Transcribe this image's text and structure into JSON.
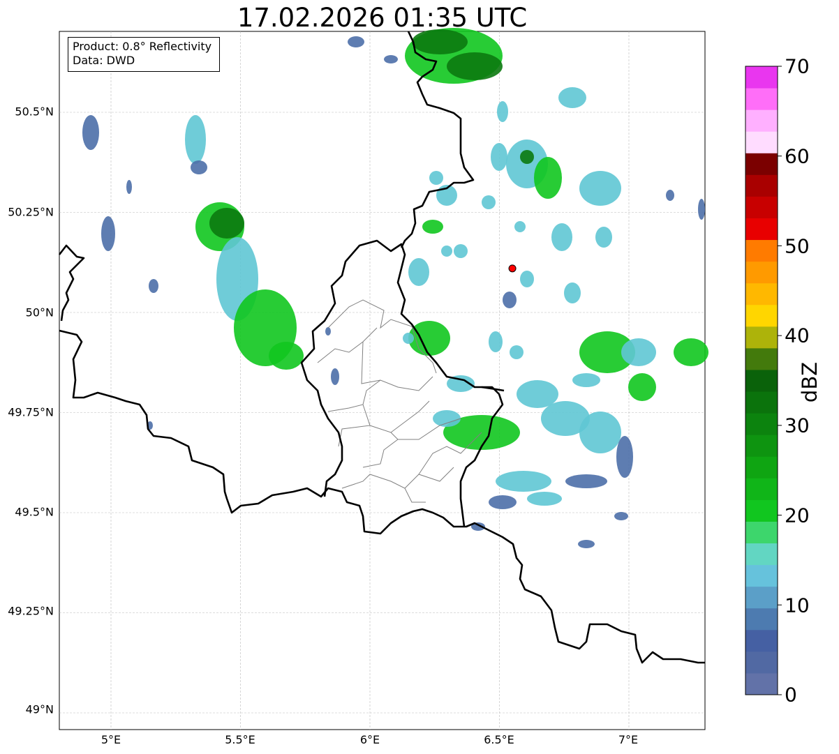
{
  "title": "17.02.2026 01:35 UTC",
  "info": {
    "product": "Product: 0.8° Reflectivity",
    "data": "Data: DWD"
  },
  "latitude_labels": [
    "50.5°N",
    "50.25°N",
    "50°N",
    "49.75°N",
    "49.5°N",
    "49.25°N",
    "49°N"
  ],
  "longitude_labels": [
    "5°E",
    "5.5°E",
    "6°E",
    "6.5°E",
    "7°E"
  ],
  "colorbar": {
    "label": "dBZ",
    "ticks": [
      "0",
      "10",
      "20",
      "30",
      "40",
      "50",
      "60",
      "70"
    ],
    "colors": [
      "#6272a8",
      "#5169a3",
      "#4560a3",
      "#4d7bb0",
      "#5b9fc8",
      "#66c2dc",
      "#62d6c2",
      "#3dd66c",
      "#11c61f",
      "#10b518",
      "#0fa512",
      "#0e9410",
      "#0c830e",
      "#0b730c",
      "#0a620a",
      "#437a0c",
      "#adb30a",
      "#ffd600",
      "#ffb800",
      "#ff9a00",
      "#ff7b00",
      "#e80000",
      "#c80000",
      "#a90000",
      "#7b0000",
      "#ffdcff",
      "#ffb0ff",
      "#ff6ef8",
      "#e936ef"
    ]
  },
  "radar_site": {
    "lon": 6.55,
    "lat": 50.11,
    "color": "#ff0000"
  },
  "colors": {
    "weak": "#4d6fa8",
    "light": "#5fc6d4",
    "moderate": "#11c61f",
    "strong": "#0b7a10",
    "border": "#000000",
    "region": "#808080"
  }
}
